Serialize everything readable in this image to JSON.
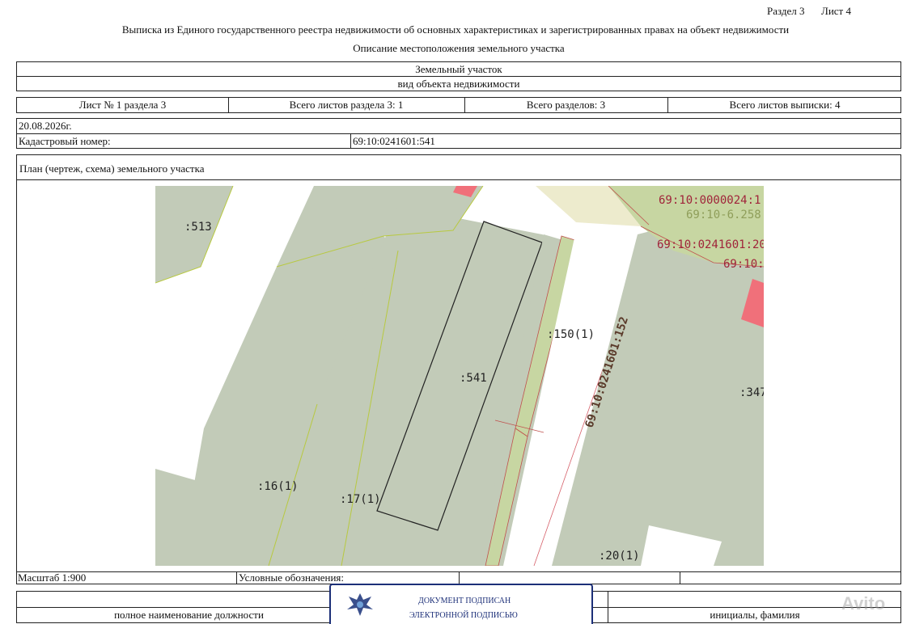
{
  "header": {
    "section": "Раздел 3",
    "sheet": "Лист 4",
    "doc_title": "Выписка из Единого государственного реестра недвижимости об основных характеристиках и зарегистрированных правах на объект недвижимости",
    "subtitle": "Описание местоположения земельного участка"
  },
  "object": {
    "type": "Земельный участок",
    "type_caption": "вид объекта недвижимости"
  },
  "sheets_row": {
    "sheet_no": "Лист № 1 раздела 3",
    "total_sheets_section": "Всего листов раздела 3: 1",
    "total_sections": "Всего разделов: 3",
    "total_sheets_extract": "Всего листов выписки: 4"
  },
  "date": "20.08.2026г.",
  "cadastral": {
    "label": "Кадастровый номер:",
    "value": "69:10:0241601:541"
  },
  "plan": {
    "title": "План (чертеж, схема) земельного участка",
    "labels": {
      "p513": ":513",
      "p541": ":541",
      "p150": ":150(1)",
      "p152": "69:10:0241601:152",
      "p347": ":347",
      "p16": ":16(1)",
      "p17": ":17(1)",
      "p20": ":20(1)",
      "q24": "69:10:0000024:1",
      "q6258": "69:10-6.258",
      "q2": "69:10:0241601:20",
      "q3": "69:10:"
    },
    "colors": {
      "parcel": "#c2cbb8",
      "road": "#ffffff",
      "strip": "#c7d6a2",
      "red_building": "#f0707a",
      "boundary": "#b8c940"
    }
  },
  "bottom": {
    "scale": "Масштаб 1:900",
    "legend": "Условные обозначения:",
    "position_caption": "полное наименование должности",
    "initials_caption": "инициалы, фамилия"
  },
  "stamp": {
    "line1": "ДОКУМЕНТ ПОДПИСАН",
    "line2": "ЭЛЕКТРОННОЙ ПОДПИСЬЮ"
  },
  "watermark": "Avito"
}
